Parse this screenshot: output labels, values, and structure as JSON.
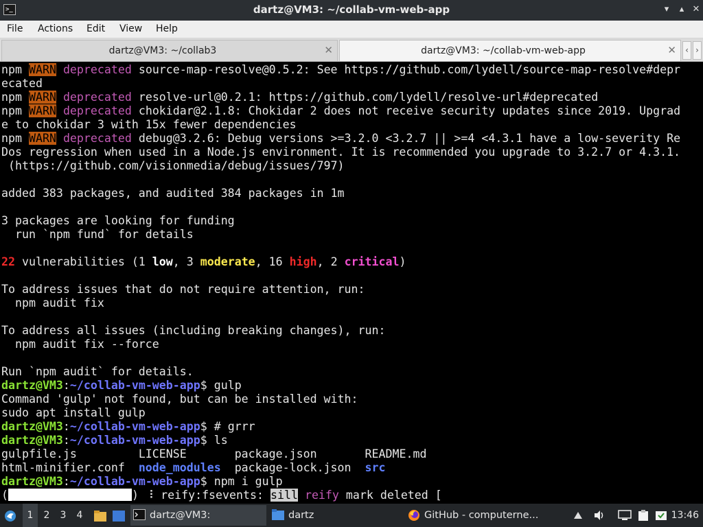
{
  "window": {
    "title": "dartz@VM3: ~/collab-vm-web-app",
    "app_icon_glyph": ">_",
    "buttons": {
      "minimize": "▾",
      "maximize": "▴",
      "close": "✕"
    }
  },
  "menu": [
    "File",
    "Actions",
    "Edit",
    "View",
    "Help"
  ],
  "tabs": [
    {
      "label": "dartz@VM3: ~/collab3",
      "active": false
    },
    {
      "label": "dartz@VM3: ~/collab-vm-web-app",
      "active": true
    }
  ],
  "tab_close_glyph": "✕",
  "tab_nav": {
    "left": "‹",
    "right": "›"
  },
  "terminal": {
    "prompt_user": "dartz@VM3",
    "prompt_path": "~/collab-vm-web-app",
    "warn": "WARN",
    "deprecated": "deprecated",
    "l01b": " source-map-resolve@0.5.2: See https://github.com/lydell/source-map-resolve#depr",
    "l02": "ecated",
    "l03b": " resolve-url@0.2.1: https://github.com/lydell/resolve-url#deprecated",
    "l04b": " chokidar@2.1.8: Chokidar 2 does not receive security updates since 2019. Upgrad",
    "l05": "e to chokidar 3 with 15x fewer dependencies",
    "l06b": " debug@3.2.6: Debug versions >=3.2.0 <3.2.7 || >=4 <4.3.1 have a low-severity Re",
    "l07": "Dos regression when used in a Node.js environment. It is recommended you upgrade to 3.2.7 or 4.3.1.",
    "l08": " (https://github.com/visionmedia/debug/issues/797)",
    "l10": "added 383 packages, and audited 384 packages in 1m",
    "l12": "3 packages are looking for funding",
    "l13": "  run `npm fund` for details",
    "vuln_count": "22",
    "vuln_text": " vulnerabilities (1 ",
    "low": "low",
    "sep1": ", 3 ",
    "moderate": "moderate",
    "sep2": ", 16 ",
    "high": "high",
    "sep3": ", 2 ",
    "critical": "critical",
    "close_paren": ")",
    "l17": "To address issues that do not require attention, run:",
    "l18": "  npm audit fix",
    "l20": "To address all issues (including breaking changes), run:",
    "l21": "  npm audit fix --force",
    "l23": "Run `npm audit` for details.",
    "cmd_gulp": "$ gulp",
    "l25": "Command 'gulp' not found, but can be installed with:",
    "l26": "sudo apt install gulp",
    "cmd_grrr": "$ # grrr",
    "cmd_ls": "$ ls",
    "ls_a1": "gulpfile.js         ",
    "ls_a2": "LICENSE       ",
    "ls_a3": "package.json       ",
    "ls_a4": "README.md",
    "ls_b1": "html-minifier.conf  ",
    "ls_b2": "node_modules",
    "ls_b2s": "  ",
    "ls_b3": "package-lock.json  ",
    "ls_b4": "src",
    "cmd_npm": "$ npm i gulp",
    "prog_open": "(",
    "prog_close": ") ⠸ reify:fsevents: ",
    "silly": "sill",
    "space": " ",
    "reify": "reify",
    "prog_tail": " mark deleted ["
  },
  "taskbar": {
    "workspaces": [
      "1",
      "2",
      "3",
      "4"
    ],
    "tasks": [
      {
        "label": "dartz@VM3: ~/collab-...",
        "active": true
      },
      {
        "label": "dartz",
        "active": false
      },
      {
        "label": "GitHub - computerne...",
        "active": false
      }
    ],
    "clock": "13:46"
  }
}
